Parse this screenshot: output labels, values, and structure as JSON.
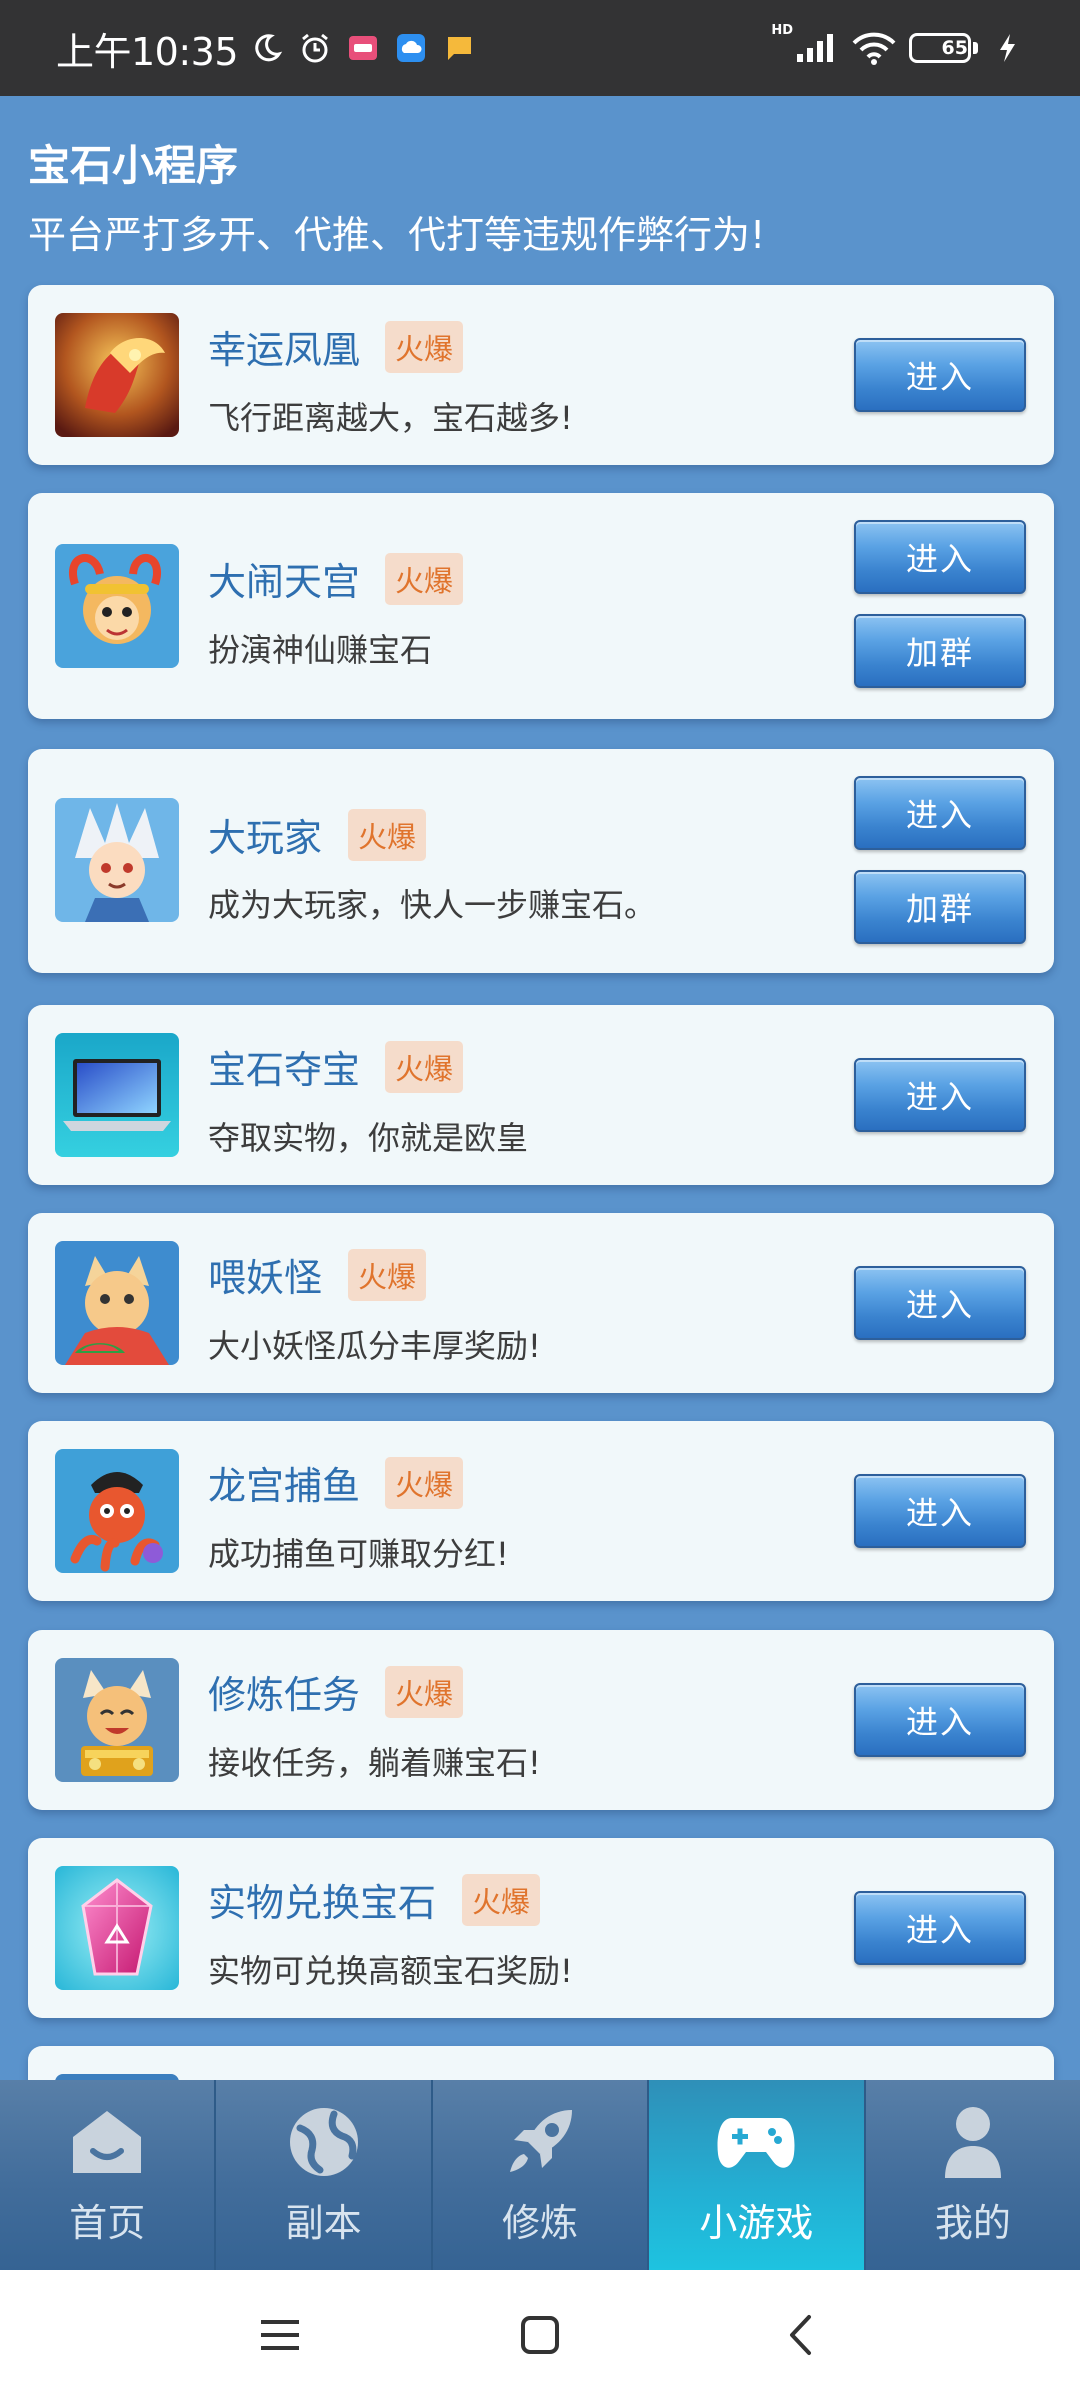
{
  "status_bar": {
    "time": "上午10:35",
    "battery_level": "65",
    "network_label": "HD",
    "icons": [
      "moon-icon",
      "alarm-icon",
      "app-notification-icon",
      "cloud-icon",
      "message-icon",
      "signal-icon",
      "wifi-icon",
      "battery-icon",
      "charging-icon"
    ]
  },
  "header": {
    "title": "宝石小程序",
    "notice": "平台严打多开、代推、代打等违规作弊行为!"
  },
  "games": [
    {
      "name": "幸运凤凰",
      "badge": "火爆",
      "desc": "飞行距离越大，宝石越多!",
      "enter_label": "进入"
    },
    {
      "name": "大闹天宫",
      "badge": "火爆",
      "desc": "扮演神仙赚宝石",
      "enter_label": "进入",
      "join_label": "加群"
    },
    {
      "name": "大玩家",
      "badge": "火爆",
      "desc": "成为大玩家，快人一步赚宝石。",
      "enter_label": "进入",
      "join_label": "加群"
    },
    {
      "name": "宝石夺宝",
      "badge": "火爆",
      "desc": "夺取实物，你就是欧皇",
      "enter_label": "进入"
    },
    {
      "name": "喂妖怪",
      "badge": "火爆",
      "desc": "大小妖怪瓜分丰厚奖励!",
      "enter_label": "进入"
    },
    {
      "name": "龙宫捕鱼",
      "badge": "火爆",
      "desc": "成功捕鱼可赚取分红!",
      "enter_label": "进入"
    },
    {
      "name": "修炼任务",
      "badge": "火爆",
      "desc": "接收任务，躺着赚宝石!",
      "enter_label": "进入"
    },
    {
      "name": "实物兑换宝石",
      "badge": "火爆",
      "desc": "实物可兑换高额宝石奖励!",
      "enter_label": "进入"
    }
  ],
  "bottom_nav": {
    "items": [
      {
        "label": "首页",
        "icon": "home-icon"
      },
      {
        "label": "副本",
        "icon": "planet-icon"
      },
      {
        "label": "修炼",
        "icon": "rocket-icon"
      },
      {
        "label": "小游戏",
        "icon": "gamepad-icon",
        "active": true
      },
      {
        "label": "我的",
        "icon": "user-icon"
      }
    ]
  },
  "system_nav": {
    "icons": [
      "menu-icon",
      "home-square-icon",
      "back-icon"
    ]
  },
  "colors": {
    "page_bg": "#5a93cc",
    "card_bg": "#f1f8fa",
    "title_blue": "#2e6fb0",
    "badge_bg": "#f5dccb",
    "badge_text": "#e0742d",
    "nav_active": "#23b0d4"
  }
}
